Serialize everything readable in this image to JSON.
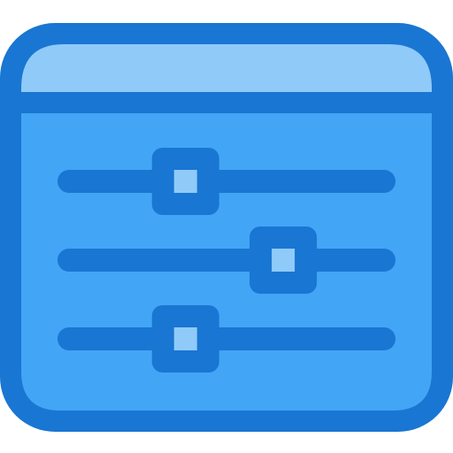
{
  "icon": {
    "name": "settings-sliders-window-icon",
    "colors": {
      "outline": "#1976D2",
      "body_fill": "#42A5F5",
      "title_bar_fill": "#90CAF9",
      "knob_center": "#90CAF9"
    }
  },
  "sliders": [
    {
      "name": "slider-1",
      "level": 0.37
    },
    {
      "name": "slider-2",
      "level": 0.68
    },
    {
      "name": "slider-3",
      "level": 0.37
    }
  ]
}
